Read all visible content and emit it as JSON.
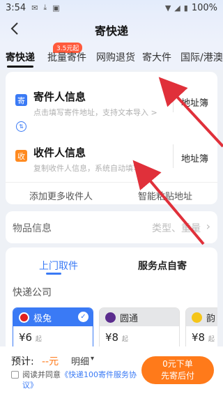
{
  "status_bar": {
    "time": "3:54",
    "battery": "100%"
  },
  "header": {
    "back_icon": "chevron-left-icon",
    "title": "寄快递"
  },
  "tabs": [
    {
      "label": "寄快递",
      "active": true
    },
    {
      "label": "批量寄件",
      "badge": "3.5元起"
    },
    {
      "label": "网购退货"
    },
    {
      "label": "寄大件"
    },
    {
      "label": "国际/港澳台"
    }
  ],
  "sender": {
    "tag": "寄",
    "title": "寄件人信息",
    "subtitle": "点击填写寄件地址，支持文本导入 >",
    "address_book": "地址簿",
    "tag_color": "#3a7af5"
  },
  "receiver": {
    "tag": "收",
    "title": "收件人信息",
    "subtitle": "复制收件人信息，系统自动填写 >",
    "address_book": "地址簿",
    "tag_color": "#ff8a1f"
  },
  "card_links": {
    "add_more": "添加更多收件人",
    "smart_paste": "智能粘贴地址"
  },
  "item_info": {
    "label": "物品信息",
    "value": "类型、重量",
    "chevron_icon": "chevron-right-icon"
  },
  "ship_mode": {
    "pickup": "上门取件",
    "self_dropoff": "服务点自寄"
  },
  "courier": {
    "heading": "快递公司",
    "companies": [
      {
        "name": "极兔",
        "price": "¥6",
        "unit": "起",
        "logo_color": "#e02020"
      },
      {
        "name": "圆通",
        "price": "¥8",
        "unit": "起",
        "logo_color": "#5b2d8e"
      },
      {
        "name": "韵",
        "price": "¥8",
        "unit": "起",
        "logo_color": "#f5c518"
      }
    ]
  },
  "footer": {
    "estimate_label": "预计:",
    "estimate_value": "--元",
    "detail": "明细",
    "agree_prefix": "阅读并同意",
    "agree_link": "《快递100寄件服务协议》",
    "cta_line1": "0元下单",
    "cta_line2": "先寄后付"
  },
  "colors": {
    "accent": "#3a7af5",
    "cta": "#ff7a1a",
    "annotation_arrow": "#e0303a"
  }
}
